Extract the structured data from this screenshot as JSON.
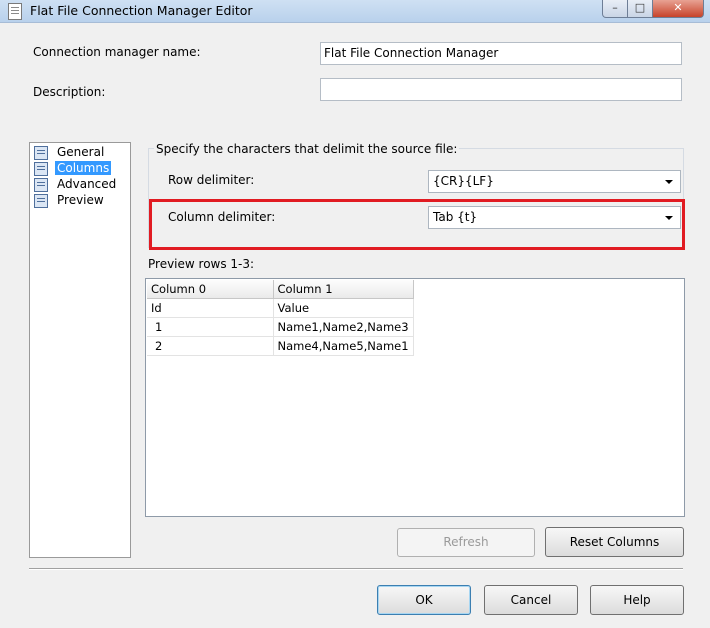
{
  "window": {
    "title": "Flat File Connection Manager Editor",
    "controls": {
      "minimize": "–",
      "maximize": "□",
      "close": "✕"
    }
  },
  "form": {
    "connection_name_label": "Connection manager name:",
    "connection_name_value": "Flat File Connection Manager",
    "description_label": "Description:",
    "description_value": ""
  },
  "nav": {
    "items": [
      {
        "label": "General",
        "icon": "general-icon",
        "selected": false
      },
      {
        "label": "Columns",
        "icon": "columns-icon",
        "selected": true
      },
      {
        "label": "Advanced",
        "icon": "advanced-icon",
        "selected": false
      },
      {
        "label": "Preview",
        "icon": "preview-icon",
        "selected": false
      }
    ]
  },
  "delimiters": {
    "group_title": "Specify the characters that delimit the source file:",
    "row_label": "Row delimiter:",
    "row_value": "{CR}{LF}",
    "column_label": "Column delimiter:",
    "column_value": "Tab {t}",
    "highlight_color": "#e11b22"
  },
  "preview": {
    "label": "Preview rows 1-3:",
    "columns": [
      "Column 0",
      "Column 1"
    ],
    "rows": [
      [
        "Id",
        "Value"
      ],
      [
        "1",
        "Name1,Name2,Name3"
      ],
      [
        "2",
        "Name4,Name5,Name1"
      ]
    ]
  },
  "buttons": {
    "refresh": "Refresh",
    "reset_columns": "Reset Columns",
    "ok": "OK",
    "cancel": "Cancel",
    "help": "Help"
  }
}
